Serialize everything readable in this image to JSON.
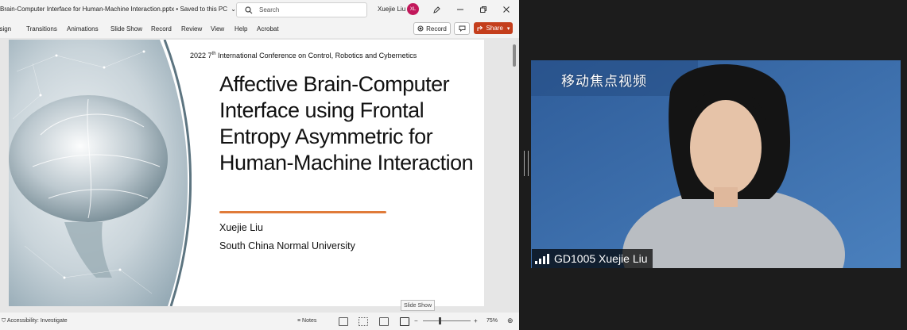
{
  "ppt": {
    "doc_title": "Brain-Computer Interface for Human-Machine Interaction.pptx • Saved to this PC",
    "search_placeholder": "Search",
    "user_name": "Xuejie Liu",
    "user_initials": "XL",
    "ribbon_tabs": [
      "esign",
      "Transitions",
      "Animations",
      "Slide Show",
      "Record",
      "Review",
      "View",
      "Help",
      "Acrobat"
    ],
    "record_label": "Record",
    "share_label": "Share",
    "slide": {
      "conference_pre": "2022 7",
      "conference_sup": "th",
      "conference_post": " International Conference on Control, Robotics and Cybernetics",
      "title": "Affective Brain-Computer Interface using Frontal Entropy Asymmetric for Human-Machine Interaction",
      "author": "Xuejie Liu",
      "affiliation": "South China Normal University"
    },
    "status": {
      "accessibility": "Accessibility: Investigate",
      "notes": "Notes",
      "zoom": "75%",
      "tooltip": "Slide Show"
    }
  },
  "video": {
    "participant": "GD1005 Xuejie Liu",
    "watermark": "移动焦点视频"
  },
  "colors": {
    "share": "#c43e1c",
    "accent_underline": "#e07b39",
    "avatar": "#c2185b",
    "video_bg": "#4270a8"
  }
}
